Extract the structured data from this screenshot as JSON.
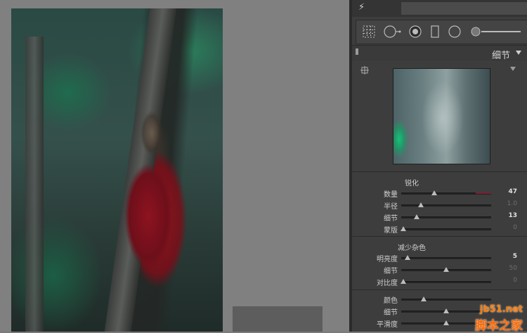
{
  "panel": {
    "section_title": "细节",
    "sharpening": {
      "title": "锐化",
      "sliders": [
        {
          "label": "数量",
          "value": "47",
          "level": 0.37,
          "dim": false,
          "accent": "#7a2030"
        },
        {
          "label": "半径",
          "value": "1.0",
          "level": 0.22,
          "dim": true
        },
        {
          "label": "细节",
          "value": "13",
          "level": 0.17,
          "dim": false
        },
        {
          "label": "蒙版",
          "value": "0",
          "level": 0.02,
          "dim": true
        }
      ]
    },
    "noise_reduction": {
      "title": "减少杂色",
      "luminance": [
        {
          "label": "明亮度",
          "value": "5",
          "level": 0.07,
          "dim": false
        },
        {
          "label": "细节",
          "value": "50",
          "level": 0.5,
          "dim": true
        },
        {
          "label": "对比度",
          "value": "0",
          "level": 0.02,
          "dim": true
        }
      ],
      "color": [
        {
          "label": "颜色",
          "value": "",
          "level": 0.25,
          "dim": true
        },
        {
          "label": "细节",
          "value": "",
          "level": 0.5,
          "dim": true
        },
        {
          "label": "平滑度",
          "value": "",
          "level": 0.5,
          "dim": true
        }
      ]
    }
  },
  "watermark": {
    "top": "jb51.net",
    "bottom": "脚本之家"
  },
  "colors": {
    "panel_bg": "#3d3d3d",
    "canvas_bg": "#808080",
    "thumb": "#bdbdbd"
  }
}
